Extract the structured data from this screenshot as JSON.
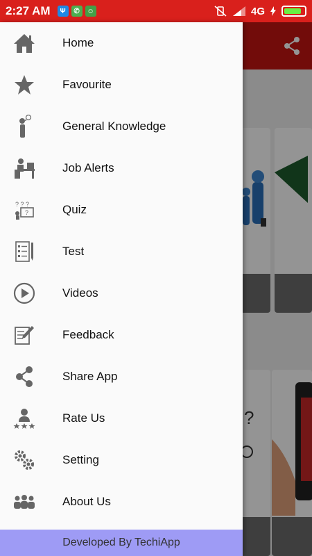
{
  "status_bar": {
    "time": "2:27 AM",
    "network": "4G",
    "battery_level": 0.85
  },
  "drawer": {
    "items": [
      {
        "label": "Home",
        "icon": "home-icon"
      },
      {
        "label": "Favourite",
        "icon": "star-icon"
      },
      {
        "label": "General Knowledge",
        "icon": "person-thinking-icon"
      },
      {
        "label": "Job Alerts",
        "icon": "person-at-desk-icon"
      },
      {
        "label": "Quiz",
        "icon": "quiz-board-icon"
      },
      {
        "label": "Test",
        "icon": "checklist-icon"
      },
      {
        "label": "Videos",
        "icon": "play-circle-icon"
      },
      {
        "label": "Feedback",
        "icon": "edit-document-icon"
      },
      {
        "label": "Share App",
        "icon": "share-icon"
      },
      {
        "label": "Rate Us",
        "icon": "rating-user-icon"
      },
      {
        "label": "Setting",
        "icon": "gears-icon"
      },
      {
        "label": "About Us",
        "icon": "group-icon"
      }
    ],
    "footer_text": "Developed By TechiApp"
  },
  "colors": {
    "status_bar": "#d9201c",
    "toolbar": "#c41512",
    "icon_gray": "#666666",
    "footer_bg": "#9e9bf5"
  }
}
